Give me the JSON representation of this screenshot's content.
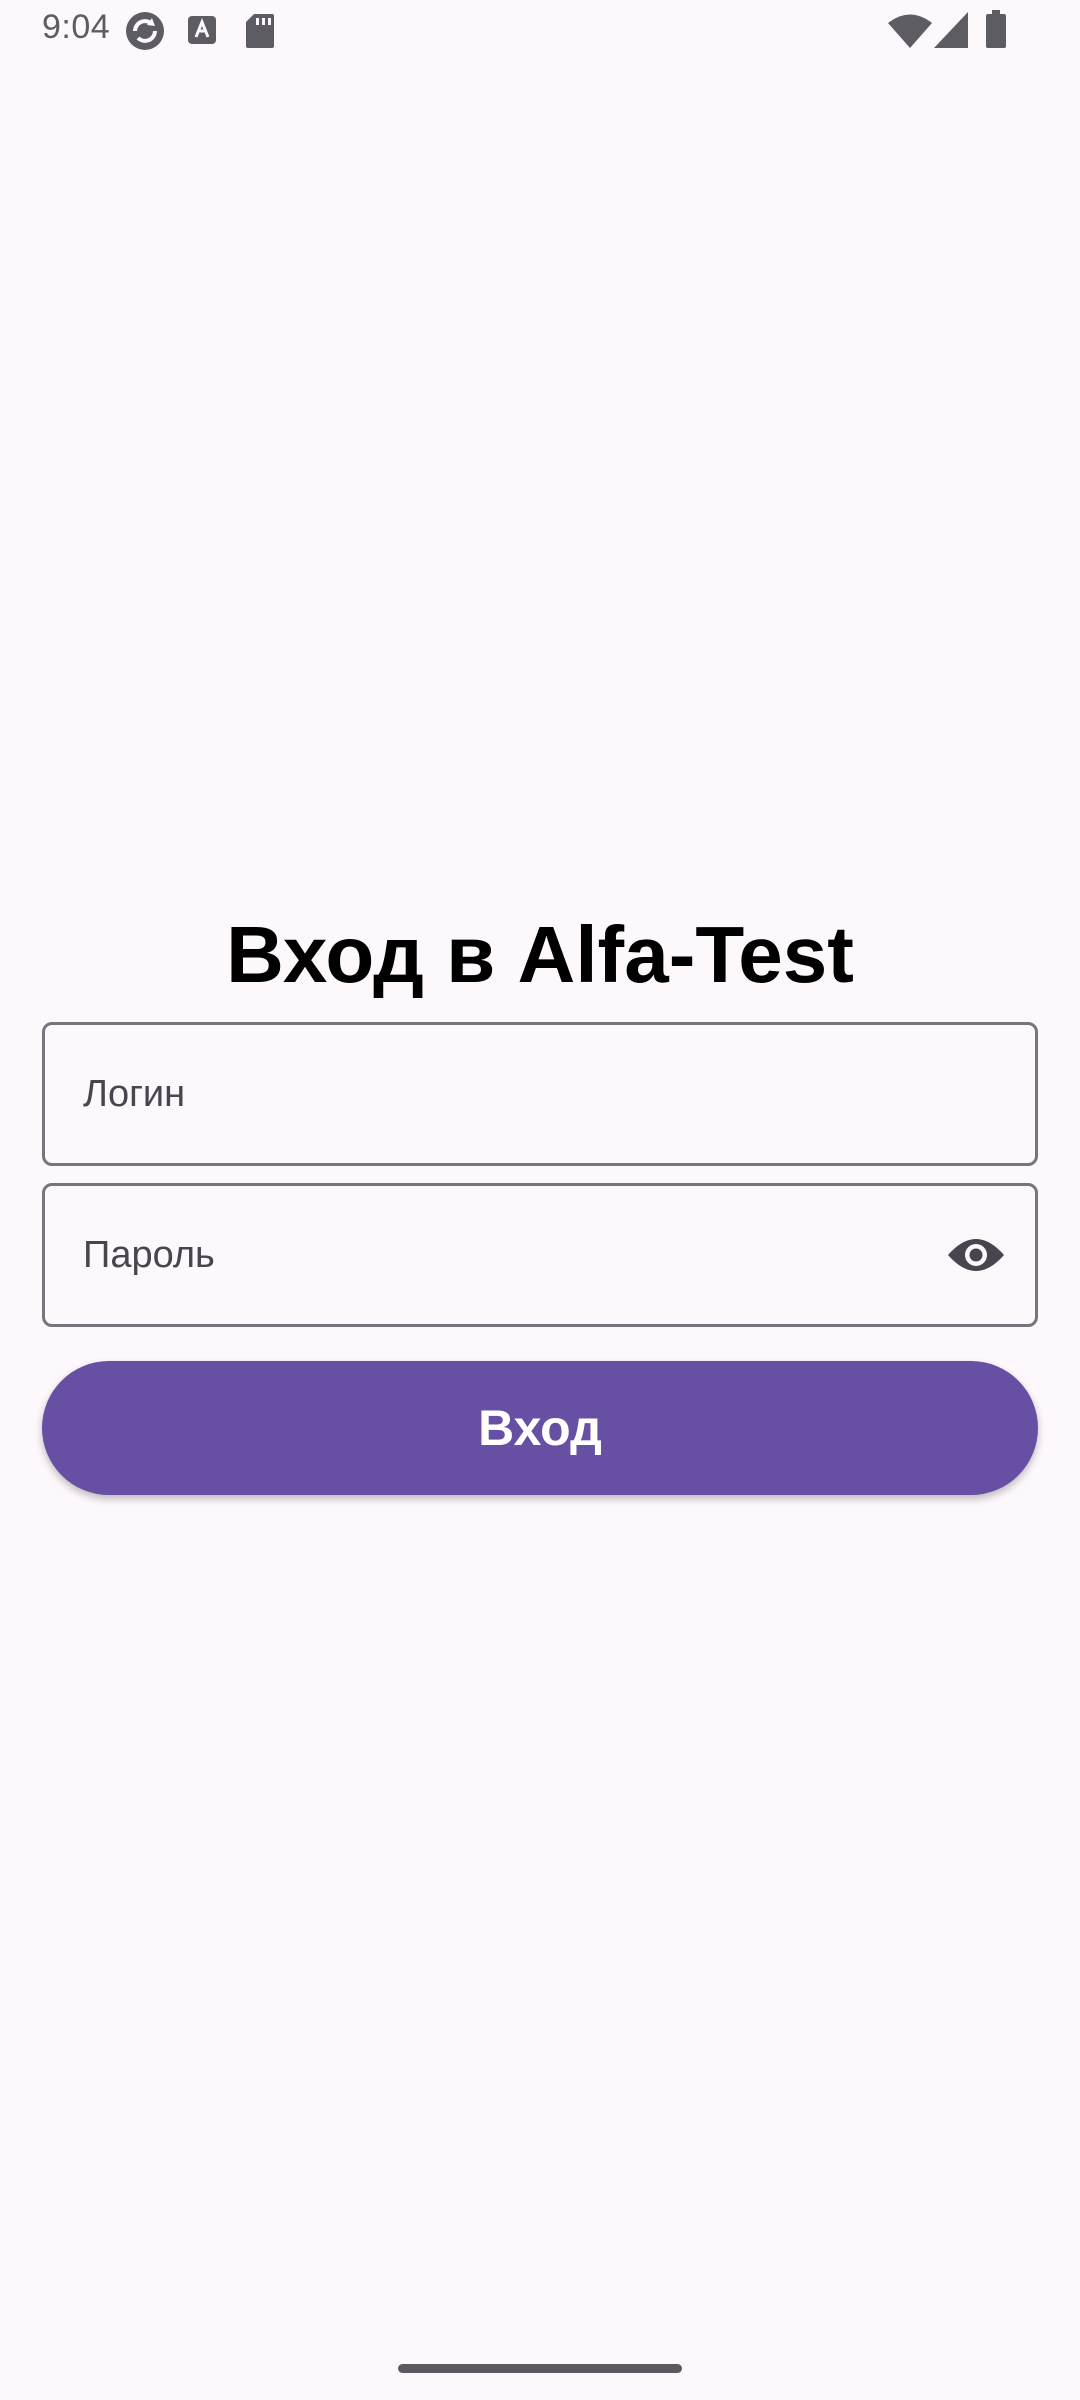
{
  "status_bar": {
    "time": "9:04",
    "icons": [
      "sync-icon",
      "font-a-icon",
      "sd-card-icon",
      "wifi-icon",
      "cellular-signal-icon",
      "battery-icon"
    ]
  },
  "login_screen": {
    "title": "Вход в Alfa-Test",
    "login_field": {
      "placeholder": "Логин",
      "value": ""
    },
    "password_field": {
      "placeholder": "Пароль",
      "value": "",
      "toggle_icon": "eye-icon"
    },
    "submit_label": "Вход"
  },
  "colors": {
    "background": "#FDF8FC",
    "primary": "#6750A4",
    "outline": "#79747E",
    "on_primary": "#FFFFFF",
    "text_secondary": "#49454F"
  }
}
